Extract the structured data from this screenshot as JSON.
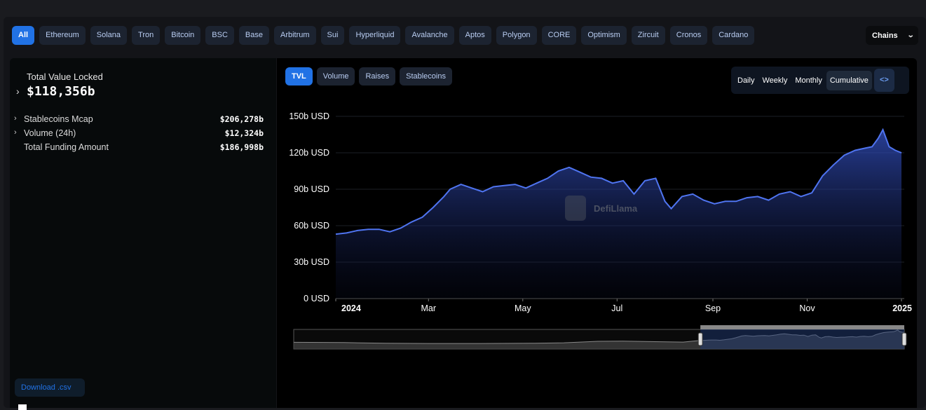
{
  "chains": {
    "items": [
      "All",
      "Ethereum",
      "Solana",
      "Tron",
      "Bitcoin",
      "BSC",
      "Base",
      "Arbitrum",
      "Sui",
      "Hyperliquid",
      "Avalanche",
      "Aptos",
      "Polygon",
      "CORE",
      "Optimism",
      "Zircuit",
      "Cronos",
      "Cardano"
    ],
    "active": "All",
    "select_label": "Chains"
  },
  "summary": {
    "tvl_label": "Total Value Locked",
    "tvl_value": "$118,356b",
    "stats": [
      {
        "label": "Stablecoins Mcap",
        "value": "$206,278b",
        "expandable": true
      },
      {
        "label": "Volume (24h)",
        "value": "$12,324b",
        "expandable": true
      },
      {
        "label": "Total Funding Amount",
        "value": "$186,998b",
        "expandable": false
      }
    ],
    "download_label": "Download .csv"
  },
  "metric_tabs": {
    "items": [
      "TVL",
      "Volume",
      "Raises",
      "Stablecoins"
    ],
    "active": "TVL"
  },
  "period_tabs": {
    "items": [
      "Daily",
      "Weekly",
      "Monthly",
      "Cumulative"
    ],
    "selected": "Cumulative",
    "embed_icon": "code-icon"
  },
  "watermark": "DefiLlama",
  "colors": {
    "accent": "#2172e5",
    "series": "#4f74f0",
    "brush": "#8a8a8a"
  },
  "chart_data": {
    "type": "area",
    "title": "",
    "xlabel": "",
    "ylabel": "",
    "ylim": [
      0,
      150
    ],
    "yticks": [
      0,
      30,
      60,
      90,
      120,
      150
    ],
    "ytick_labels": [
      "0 USD",
      "30b USD",
      "60b USD",
      "90b USD",
      "120b USD",
      "150b USD"
    ],
    "xlim": [
      "2024-01-01",
      "2025-01-01"
    ],
    "xticks": [
      {
        "date": "2024-01-01",
        "label": "2024",
        "bold": true
      },
      {
        "date": "2024-03-01",
        "label": "Mar",
        "bold": false
      },
      {
        "date": "2024-05-01",
        "label": "May",
        "bold": false
      },
      {
        "date": "2024-07-01",
        "label": "Jul",
        "bold": false
      },
      {
        "date": "2024-09-01",
        "label": "Sep",
        "bold": false
      },
      {
        "date": "2024-11-01",
        "label": "Nov",
        "bold": false
      },
      {
        "date": "2025-01-01",
        "label": "2025",
        "bold": true
      }
    ],
    "grid": true,
    "series": [
      {
        "x": [
          "2024-01-01",
          "2024-01-08",
          "2024-01-15",
          "2024-01-22",
          "2024-01-29",
          "2024-02-05",
          "2024-02-12",
          "2024-02-19",
          "2024-02-26",
          "2024-03-04",
          "2024-03-11",
          "2024-03-15",
          "2024-03-22",
          "2024-03-29",
          "2024-04-05",
          "2024-04-12",
          "2024-04-19",
          "2024-04-26",
          "2024-05-03",
          "2024-05-10",
          "2024-05-17",
          "2024-05-24",
          "2024-05-31",
          "2024-06-07",
          "2024-06-14",
          "2024-06-21",
          "2024-06-28",
          "2024-07-05",
          "2024-07-12",
          "2024-07-19",
          "2024-07-26",
          "2024-08-01",
          "2024-08-05",
          "2024-08-12",
          "2024-08-19",
          "2024-08-26",
          "2024-09-02",
          "2024-09-09",
          "2024-09-16",
          "2024-09-23",
          "2024-09-30",
          "2024-10-07",
          "2024-10-14",
          "2024-10-21",
          "2024-10-28",
          "2024-11-04",
          "2024-11-11",
          "2024-11-18",
          "2024-11-25",
          "2024-12-02",
          "2024-12-09",
          "2024-12-13",
          "2024-12-17",
          "2024-12-20",
          "2024-12-24",
          "2024-12-28",
          "2025-01-01"
        ],
        "y": [
          53,
          54,
          56,
          57,
          57,
          55,
          58,
          63,
          67,
          75,
          84,
          90,
          94,
          91,
          88,
          92,
          93,
          94,
          91,
          95,
          99,
          105,
          108,
          104,
          100,
          99,
          95,
          97,
          86,
          97,
          99,
          80,
          74,
          84,
          86,
          81,
          78,
          80,
          80,
          83,
          84,
          81,
          86,
          88,
          84,
          87,
          101,
          110,
          118,
          122,
          124,
          125,
          132,
          139,
          125,
          122,
          120
        ]
      }
    ],
    "brush": {
      "selected_from": "2024-01-01",
      "selected_to": "2025-01-01"
    }
  }
}
